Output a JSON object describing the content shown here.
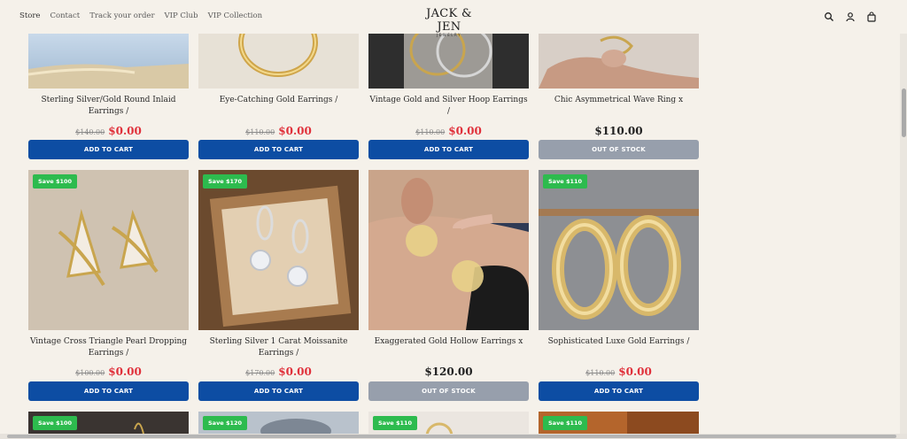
{
  "nav": {
    "items": [
      "Store",
      "Contact",
      "Track your order",
      "VIP Club",
      "VIP Collection"
    ]
  },
  "logo": {
    "brand": "JACK & JEN",
    "sub": "JEWELRY"
  },
  "header_icons": [
    "search-icon",
    "user-icon",
    "cart-icon"
  ],
  "colors": {
    "background": "#f5f1ea",
    "add_button": "#0d4da3",
    "out_of_stock_button": "#979fac",
    "sale_price": "#e0313b",
    "badge": "#2dbb4e"
  },
  "products": {
    "row1": [
      {
        "title": "Sterling Silver/Gold Round Inlaid Earrings /",
        "old_price": "$140.00",
        "price": "$0.00",
        "button": "ADD TO CART"
      },
      {
        "title": "Eye-Catching Gold Earrings /",
        "old_price": "$110.00",
        "price": "$0.00",
        "button": "ADD TO CART"
      },
      {
        "title": "Vintage Gold and Silver Hoop Earrings /",
        "old_price": "$110.00",
        "price": "$0.00",
        "button": "ADD TO CART"
      },
      {
        "title": "Chic Asymmetrical Wave Ring x",
        "price": "$110.00",
        "button": "OUT OF STOCK"
      }
    ],
    "row2": [
      {
        "badge": "Save $100",
        "title": "Vintage Cross Triangle Pearl Dropping Earrings /",
        "old_price": "$100.00",
        "price": "$0.00",
        "button": "ADD TO CART"
      },
      {
        "badge": "Save $170",
        "title": "Sterling Silver 1 Carat Moissanite Earrings /",
        "old_price": "$170.00",
        "price": "$0.00",
        "button": "ADD TO CART"
      },
      {
        "title": "Exaggerated Gold Hollow Earrings x",
        "price": "$120.00",
        "button": "OUT OF STOCK"
      },
      {
        "badge": "Save $110",
        "title": "Sophisticated Luxe Gold Earrings /",
        "old_price": "$110.00",
        "price": "$0.00",
        "button": "ADD TO CART"
      }
    ],
    "row3": [
      {
        "badge": "Save $100"
      },
      {
        "badge": "Save $120"
      },
      {
        "badge": "Save $110"
      },
      {
        "badge": "Save $110"
      }
    ]
  }
}
